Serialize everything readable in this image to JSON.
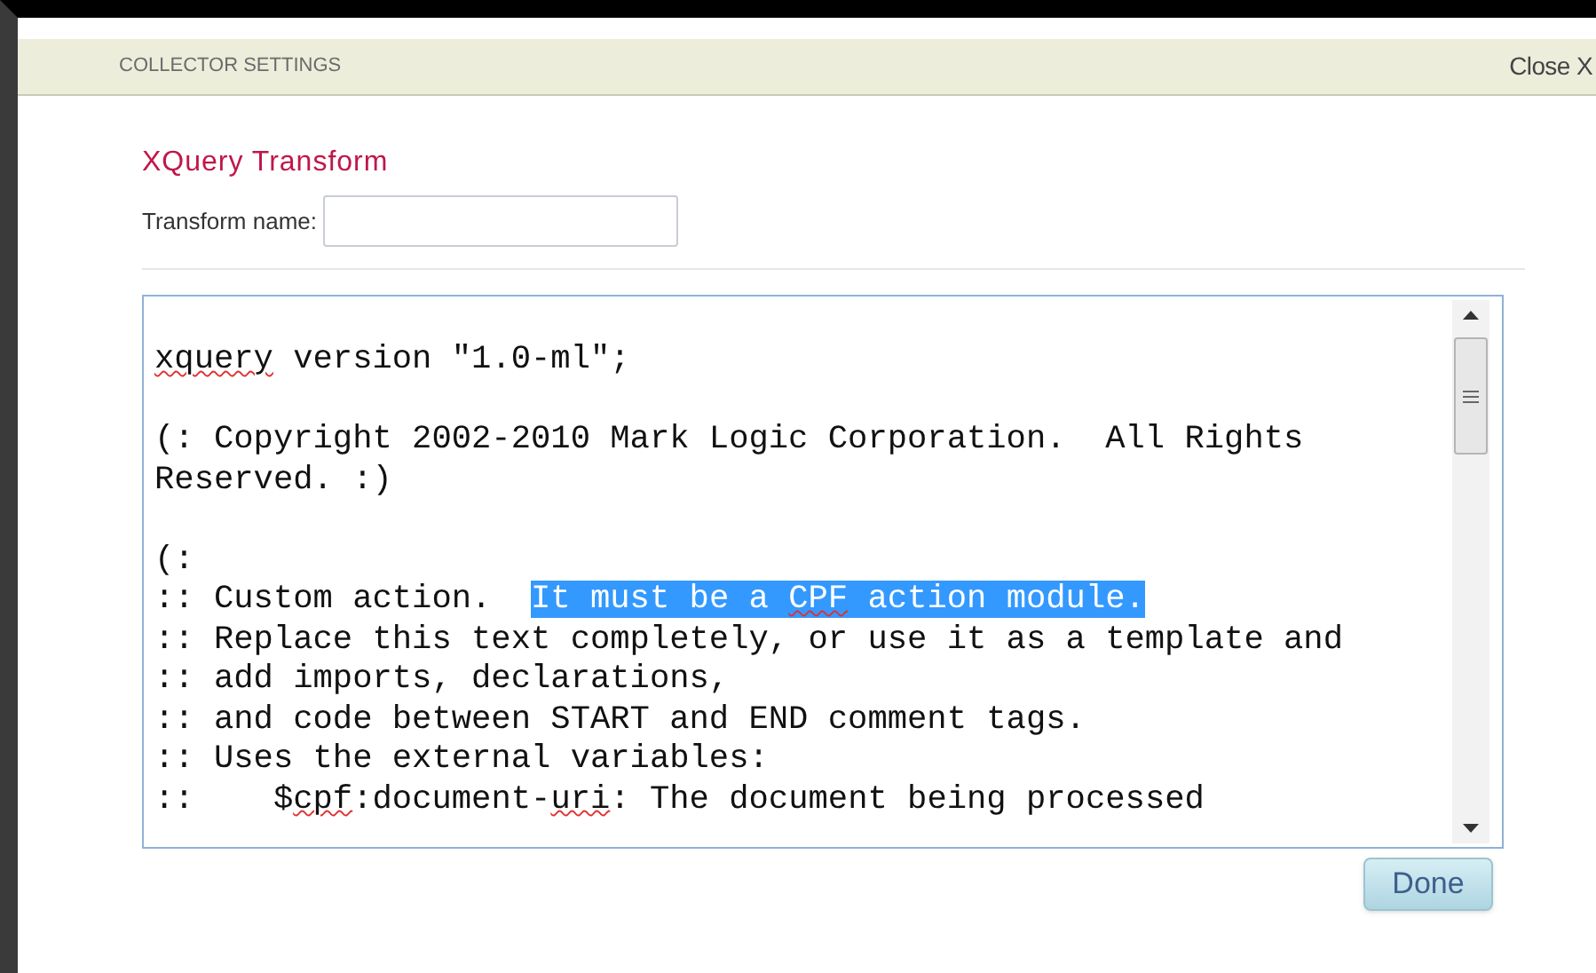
{
  "header": {
    "title": "COLLECTOR SETTINGS",
    "close": "Close X"
  },
  "section_title": "XQuery Transform",
  "transform_name": {
    "label": "Transform name:"
  },
  "code_lines": [
    {
      "kind": "text",
      "segments": [
        {
          "text": "xquery",
          "selected": false,
          "misspelled": true
        },
        {
          "text": " version \"1.0-ml\";",
          "selected": false,
          "misspelled": false
        }
      ]
    },
    {
      "kind": "blank"
    },
    {
      "kind": "text",
      "segments": [
        {
          "text": "(: Copyright 2002-2010 Mark Logic Corporation.  All Rights",
          "selected": false,
          "misspelled": false
        }
      ]
    },
    {
      "kind": "text",
      "segments": [
        {
          "text": "Reserved. :)",
          "selected": false,
          "misspelled": false
        }
      ]
    },
    {
      "kind": "blank"
    },
    {
      "kind": "text",
      "segments": [
        {
          "text": "(:",
          "selected": false,
          "misspelled": false
        }
      ]
    },
    {
      "kind": "text",
      "segments": [
        {
          "text": ":: Custom action.  ",
          "selected": false,
          "misspelled": false
        },
        {
          "text": "It must be a ",
          "selected": true,
          "misspelled": false
        },
        {
          "text": "CPF",
          "selected": true,
          "misspelled": true
        },
        {
          "text": " action module.",
          "selected": true,
          "misspelled": false
        }
      ]
    },
    {
      "kind": "text",
      "segments": [
        {
          "text": ":: Replace this text completely, or use it as a template and",
          "selected": false,
          "misspelled": false
        }
      ]
    },
    {
      "kind": "text",
      "segments": [
        {
          "text": ":: add imports, declarations,",
          "selected": false,
          "misspelled": false
        }
      ]
    },
    {
      "kind": "text",
      "segments": [
        {
          "text": ":: and code between START and END comment tags.",
          "selected": false,
          "misspelled": false
        }
      ]
    },
    {
      "kind": "text",
      "segments": [
        {
          "text": ":: Uses the external variables:",
          "selected": false,
          "misspelled": false
        }
      ]
    },
    {
      "kind": "text",
      "segments": [
        {
          "text": "::    $",
          "selected": false,
          "misspelled": false
        },
        {
          "text": "cpf",
          "selected": false,
          "misspelled": true
        },
        {
          "text": ":document-",
          "selected": false,
          "misspelled": false
        },
        {
          "text": "uri",
          "selected": false,
          "misspelled": true
        },
        {
          "text": ": The document being processed",
          "selected": false,
          "misspelled": false
        }
      ]
    }
  ],
  "done_button": "Done"
}
